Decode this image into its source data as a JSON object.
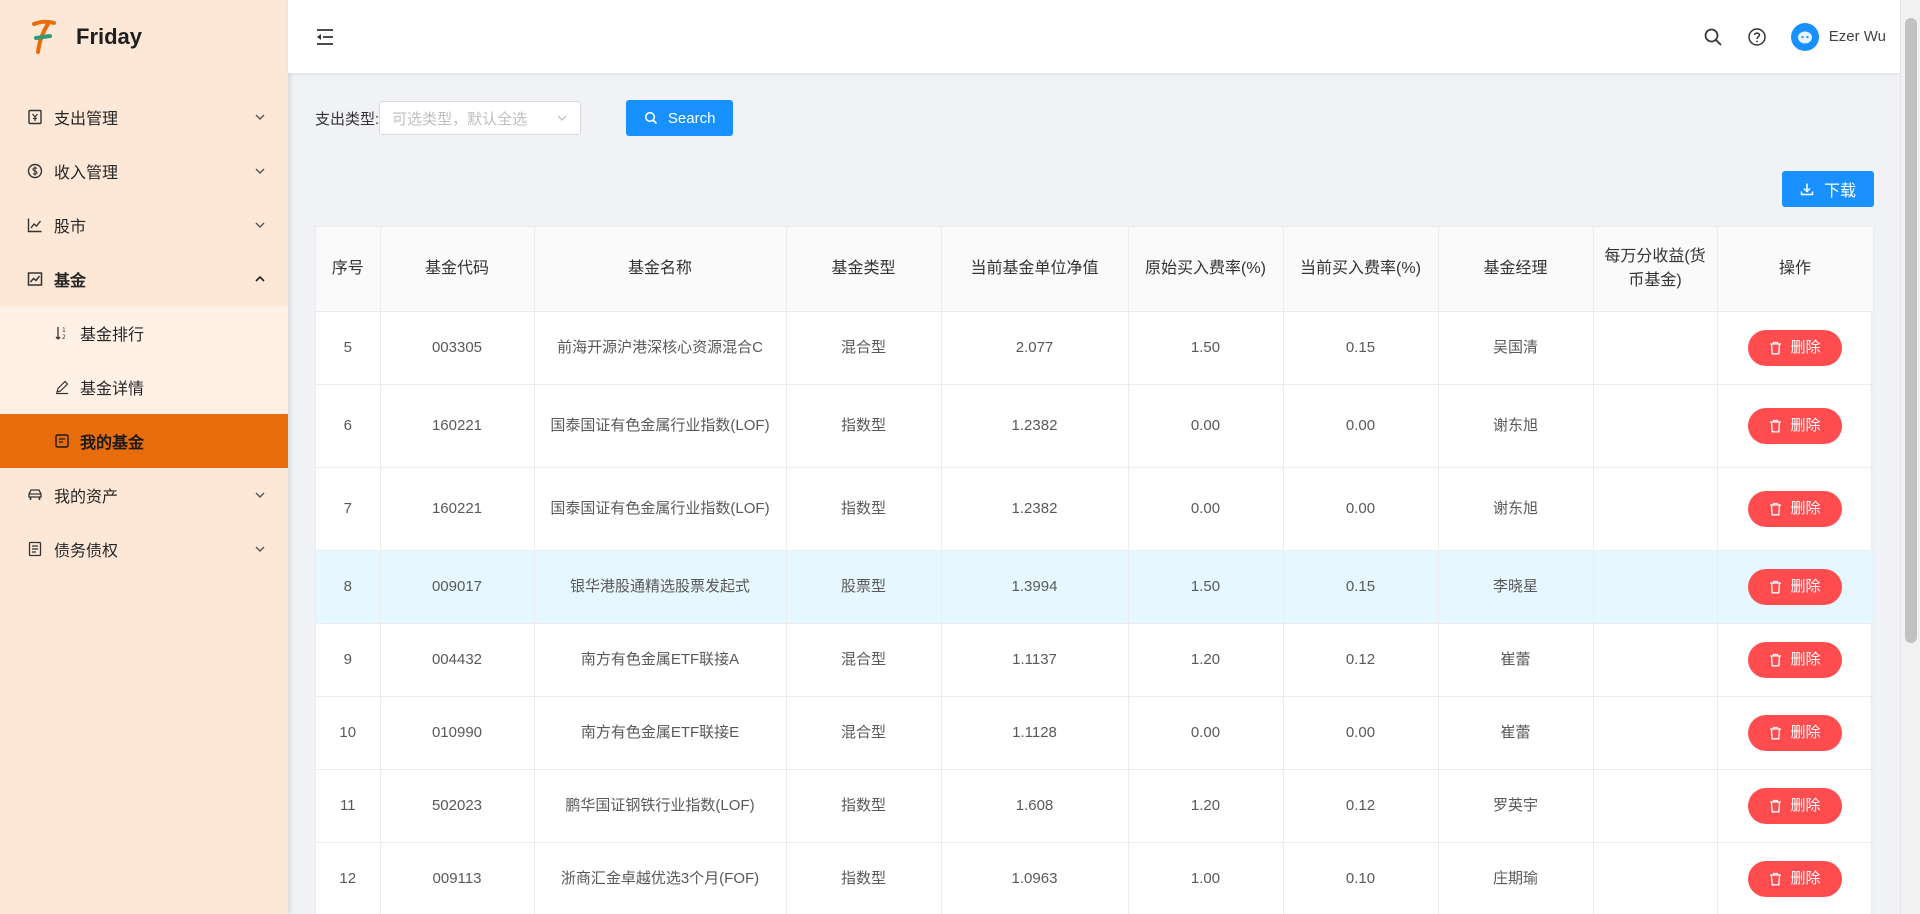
{
  "app": {
    "name": "Friday"
  },
  "sidebar": {
    "menu": [
      {
        "label": "支出管理"
      },
      {
        "label": "收入管理"
      },
      {
        "label": "股市"
      },
      {
        "label": "基金"
      },
      {
        "label": "我的资产"
      },
      {
        "label": "债务债权"
      }
    ],
    "fund_sub": [
      {
        "label": "基金排行"
      },
      {
        "label": "基金详情"
      },
      {
        "label": "我的基金"
      }
    ]
  },
  "header": {
    "user_name": "Ezer Wu"
  },
  "filter": {
    "label": "支出类型:",
    "placeholder": "可选类型，默认全选",
    "search_label": "Search"
  },
  "download_label": "下载",
  "table": {
    "headers": [
      "序号",
      "基金代码",
      "基金名称",
      "基金类型",
      "当前基金单位净值",
      "原始买入费率(%)",
      "当前买入费率(%)",
      "基金经理",
      "每万分收益(货币基金)",
      "操作"
    ],
    "delete_label": "删除",
    "rows": [
      {
        "idx": "5",
        "code": "003305",
        "name": "前海开源沪港深核心资源混合C",
        "type": "混合型",
        "nav": "2.077",
        "orig_fee": "1.50",
        "cur_fee": "0.15",
        "manager": "吴国清",
        "yield": ""
      },
      {
        "idx": "6",
        "code": "160221",
        "name": "国泰国证有色金属行业指数(LOF)",
        "type": "指数型",
        "nav": "1.2382",
        "orig_fee": "0.00",
        "cur_fee": "0.00",
        "manager": "谢东旭",
        "yield": ""
      },
      {
        "idx": "7",
        "code": "160221",
        "name": "国泰国证有色金属行业指数(LOF)",
        "type": "指数型",
        "nav": "1.2382",
        "orig_fee": "0.00",
        "cur_fee": "0.00",
        "manager": "谢东旭",
        "yield": ""
      },
      {
        "idx": "8",
        "code": "009017",
        "name": "银华港股通精选股票发起式",
        "type": "股票型",
        "nav": "1.3994",
        "orig_fee": "1.50",
        "cur_fee": "0.15",
        "manager": "李晓星",
        "yield": ""
      },
      {
        "idx": "9",
        "code": "004432",
        "name": "南方有色金属ETF联接A",
        "type": "混合型",
        "nav": "1.1137",
        "orig_fee": "1.20",
        "cur_fee": "0.12",
        "manager": "崔蕾",
        "yield": ""
      },
      {
        "idx": "10",
        "code": "010990",
        "name": "南方有色金属ETF联接E",
        "type": "混合型",
        "nav": "1.1128",
        "orig_fee": "0.00",
        "cur_fee": "0.00",
        "manager": "崔蕾",
        "yield": ""
      },
      {
        "idx": "11",
        "code": "502023",
        "name": "鹏华国证钢铁行业指数(LOF)",
        "type": "指数型",
        "nav": "1.608",
        "orig_fee": "1.20",
        "cur_fee": "0.12",
        "manager": "罗英宇",
        "yield": ""
      },
      {
        "idx": "12",
        "code": "009113",
        "name": "浙商汇金卓越优选3个月(FOF)",
        "type": "指数型",
        "nav": "1.0963",
        "orig_fee": "1.00",
        "cur_fee": "0.10",
        "manager": "庄期瑜",
        "yield": ""
      }
    ]
  },
  "colors": {
    "accent": "#1890ff",
    "active_menu": "#e86c0a",
    "danger": "#ff4d4f",
    "sidebar_bg": "#fde8d7"
  }
}
